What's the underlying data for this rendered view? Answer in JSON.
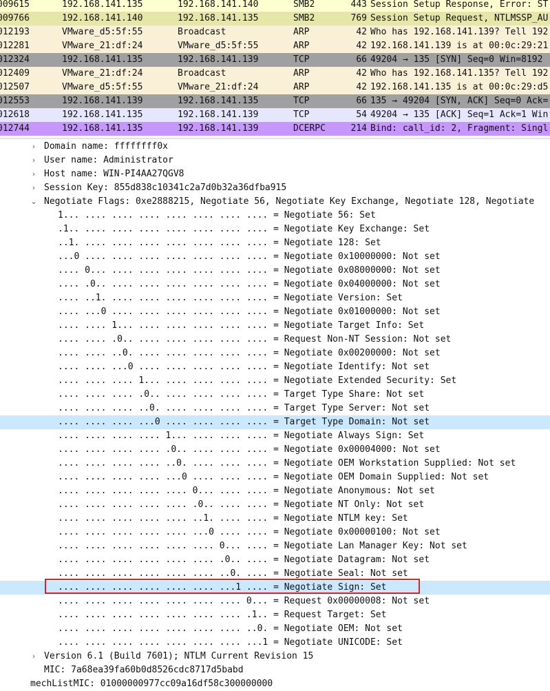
{
  "colors": {
    "smb": "#feffd0",
    "smb_selected": "#e7e6aa",
    "arp": "#faf0d7",
    "tcp_syn": "#a0a0a0",
    "tcp": "#e7e6ff",
    "dcerpc": "#c797ff",
    "selected_detail": "#cce8ff",
    "annotation_box": "#d82424"
  },
  "packets": [
    {
      "no": "009615",
      "src": "192.168.141.135",
      "dst": "192.168.141.140",
      "proto": "SMB2",
      "len": "443",
      "info": "Session Setup Response, Error: ST"
    },
    {
      "no": "009766",
      "src": "192.168.141.140",
      "dst": "192.168.141.135",
      "proto": "SMB2",
      "len": "769",
      "info": "Session Setup Request, NTLMSSP_AU"
    },
    {
      "no": "012193",
      "src": "VMware_d5:5f:55",
      "dst": "Broadcast",
      "proto": "ARP",
      "len": "42",
      "info": "Who has 192.168.141.139? Tell 192"
    },
    {
      "no": "012281",
      "src": "VMware_21:df:24",
      "dst": "VMware_d5:5f:55",
      "proto": "ARP",
      "len": "42",
      "info": "192.168.141.139 is at 00:0c:29:21"
    },
    {
      "no": "012324",
      "src": "192.168.141.135",
      "dst": "192.168.141.139",
      "proto": "TCP",
      "len": "66",
      "info": "49204 → 135 [SYN] Seq=0 Win=8192"
    },
    {
      "no": "012409",
      "src": "VMware_21:df:24",
      "dst": "Broadcast",
      "proto": "ARP",
      "len": "42",
      "info": "Who has 192.168.141.135? Tell 192"
    },
    {
      "no": "012507",
      "src": "VMware_d5:5f:55",
      "dst": "VMware_21:df:24",
      "proto": "ARP",
      "len": "42",
      "info": "192.168.141.135 is at 00:0c:29:d5"
    },
    {
      "no": "012553",
      "src": "192.168.141.139",
      "dst": "192.168.141.135",
      "proto": "TCP",
      "len": "66",
      "info": "135 → 49204 [SYN, ACK] Seq=0 Ack="
    },
    {
      "no": "012618",
      "src": "192.168.141.135",
      "dst": "192.168.141.139",
      "proto": "TCP",
      "len": "54",
      "info": "49204 → 135 [ACK] Seq=1 Ack=1 Win"
    },
    {
      "no": "012744",
      "src": "192.168.141.135",
      "dst": "192.168.141.139",
      "proto": "DCERPC",
      "len": "214",
      "info": "Bind: call_id: 2, Fragment: Singl"
    }
  ],
  "details": {
    "fields": [
      "Domain name: ffffffff0x",
      "User name: Administrator",
      "Host name: WIN-PI4AA27QGV8",
      "Session Key: 855d838c10341c2a7d0b32a36dfba915",
      "Negotiate Flags: 0xe2888215, Negotiate 56, Negotiate Key Exchange, Negotiate 128, Negotiate"
    ],
    "flags": [
      "1... .... .... .... .... .... .... .... = Negotiate 56: Set",
      ".1.. .... .... .... .... .... .... .... = Negotiate Key Exchange: Set",
      "..1. .... .... .... .... .... .... .... = Negotiate 128: Set",
      "...0 .... .... .... .... .... .... .... = Negotiate 0x10000000: Not set",
      ".... 0... .... .... .... .... .... .... = Negotiate 0x08000000: Not set",
      ".... .0.. .... .... .... .... .... .... = Negotiate 0x04000000: Not set",
      ".... ..1. .... .... .... .... .... .... = Negotiate Version: Set",
      ".... ...0 .... .... .... .... .... .... = Negotiate 0x01000000: Not set",
      ".... .... 1... .... .... .... .... .... = Negotiate Target Info: Set",
      ".... .... .0.. .... .... .... .... .... = Request Non-NT Session: Not set",
      ".... .... ..0. .... .... .... .... .... = Negotiate 0x00200000: Not set",
      ".... .... ...0 .... .... .... .... .... = Negotiate Identify: Not set",
      ".... .... .... 1... .... .... .... .... = Negotiate Extended Security: Set",
      ".... .... .... .0.. .... .... .... .... = Target Type Share: Not set",
      ".... .... .... ..0. .... .... .... .... = Target Type Server: Not set",
      ".... .... .... ...0 .... .... .... .... = Target Type Domain: Not set",
      ".... .... .... .... 1... .... .... .... = Negotiate Always Sign: Set",
      ".... .... .... .... .0.. .... .... .... = Negotiate 0x00004000: Not set",
      ".... .... .... .... ..0. .... .... .... = Negotiate OEM Workstation Supplied: Not set",
      ".... .... .... .... ...0 .... .... .... = Negotiate OEM Domain Supplied: Not set",
      ".... .... .... .... .... 0... .... .... = Negotiate Anonymous: Not set",
      ".... .... .... .... .... .0.. .... .... = Negotiate NT Only: Not set",
      ".... .... .... .... .... ..1. .... .... = Negotiate NTLM key: Set",
      ".... .... .... .... .... ...0 .... .... = Negotiate 0x00000100: Not set",
      ".... .... .... .... .... .... 0... .... = Negotiate Lan Manager Key: Not set",
      ".... .... .... .... .... .... .0.. .... = Negotiate Datagram: Not set",
      ".... .... .... .... .... .... ..0. .... = Negotiate Seal: Not set",
      ".... .... .... .... .... .... ...1 .... = Negotiate Sign: Set",
      ".... .... .... .... .... .... .... 0... = Request 0x00000008: Not set",
      ".... .... .... .... .... .... .... .1.. = Request Target: Set",
      ".... .... .... .... .... .... .... ..0. = Negotiate OEM: Not set",
      ".... .... .... .... .... .... .... ...1 = Negotiate UNICODE: Set"
    ],
    "version": "Version 6.1 (Build 7601); NTLM Current Revision 15",
    "mic": "MIC: 7a68ea39fa60b0d8526cdc8717d5babd",
    "mechlistmic": "mechListMIC: 01000000977cc09a16df58c300000000"
  }
}
